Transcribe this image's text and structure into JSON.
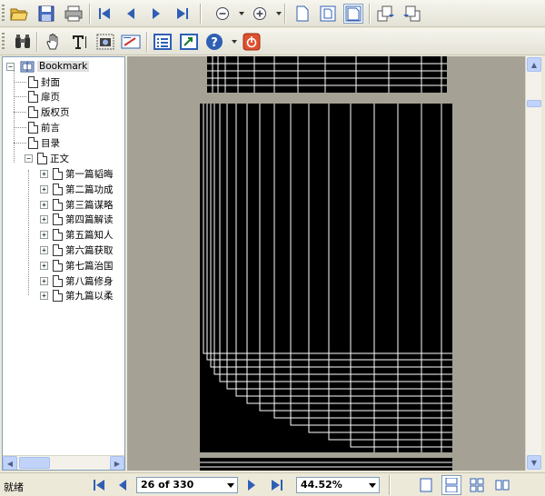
{
  "toolbar1": {
    "buttons": [
      "open-icon",
      "save-icon",
      "print-icon",
      "first-page-icon",
      "previous-page-icon",
      "next-page-icon",
      "last-page-icon",
      "zoom-out-icon",
      "zoom-in-icon",
      "actual-size-icon",
      "fit-page-icon",
      "fit-width-icon",
      "rotate-clockwise-icon",
      "rotate-counterclockwise-icon"
    ]
  },
  "toolbar2": {
    "buttons": [
      "find-icon",
      "hand-tool-icon",
      "text-select-icon",
      "snapshot-icon",
      "annotation-icon",
      "bookmark-panel-icon",
      "go-to-icon",
      "help-icon",
      "exit-icon"
    ]
  },
  "sidebar": {
    "root_label": "Bookmark",
    "items": [
      {
        "label": "封面",
        "expandable": false
      },
      {
        "label": "扉页",
        "expandable": false
      },
      {
        "label": "版权页",
        "expandable": false
      },
      {
        "label": "前言",
        "expandable": false
      },
      {
        "label": "目录",
        "expandable": false
      },
      {
        "label": "正文",
        "expandable": true,
        "expanded": true
      }
    ],
    "children": [
      {
        "label": "第一篇韬晦"
      },
      {
        "label": "第二篇功成"
      },
      {
        "label": "第三篇谋略"
      },
      {
        "label": "第四篇解读"
      },
      {
        "label": "第五篇知人"
      },
      {
        "label": "第六篇获取"
      },
      {
        "label": "第七篇治国"
      },
      {
        "label": "第八篇修身"
      },
      {
        "label": "第九篇以柔"
      }
    ]
  },
  "status": {
    "text": "就绪",
    "page_indicator": "26 of 330",
    "zoom": "44.52%"
  },
  "colors": {
    "viewer_bg": "#a5a295",
    "toolbar_bg": "#ece9d8",
    "accent_blue": "#2f5fb5"
  }
}
